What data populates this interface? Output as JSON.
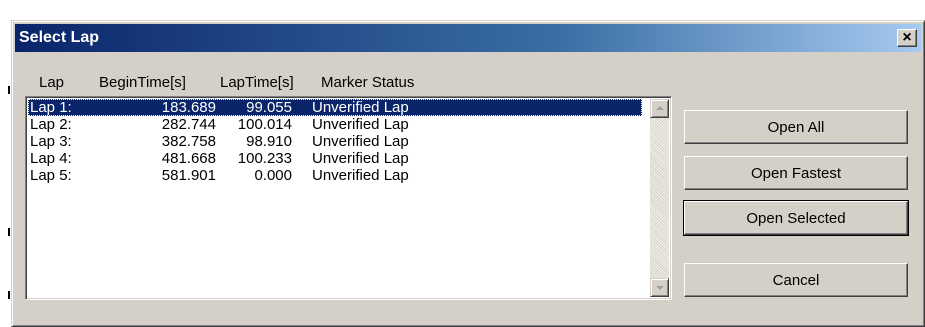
{
  "dialog": {
    "title": "Select Lap",
    "close_glyph": "×"
  },
  "columns": {
    "lap": "Lap",
    "begin": "BeginTime[s]",
    "laptime": "LapTime[s]",
    "status": "Marker Status"
  },
  "laps": [
    {
      "lap": "Lap 1:",
      "begin": "183.689",
      "laptime": "99.055",
      "status": "Unverified Lap",
      "selected": true
    },
    {
      "lap": "Lap 2:",
      "begin": "282.744",
      "laptime": "100.014",
      "status": "Unverified Lap",
      "selected": false
    },
    {
      "lap": "Lap 3:",
      "begin": "382.758",
      "laptime": "98.910",
      "status": "Unverified Lap",
      "selected": false
    },
    {
      "lap": "Lap 4:",
      "begin": "481.668",
      "laptime": "100.233",
      "status": "Unverified Lap",
      "selected": false
    },
    {
      "lap": "Lap 5:",
      "begin": "581.901",
      "laptime": "0.000",
      "status": "Unverified Lap",
      "selected": false
    }
  ],
  "buttons": {
    "open_all": "Open All",
    "open_fastest": "Open Fastest",
    "open_selected": "Open Selected",
    "cancel": "Cancel"
  }
}
